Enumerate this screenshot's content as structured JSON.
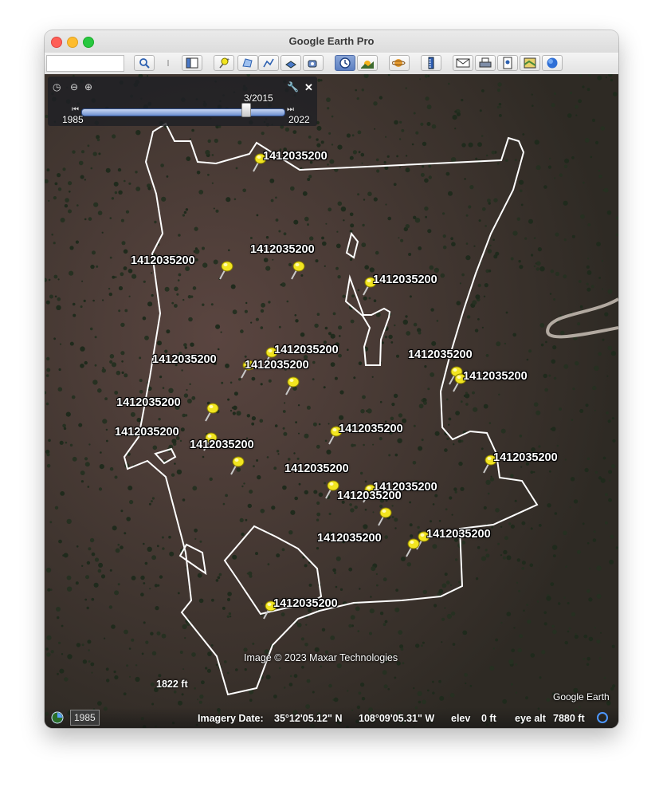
{
  "window": {
    "title": "Google Earth Pro"
  },
  "toolbar": {
    "buttons": [
      {
        "name": "search-icon",
        "state": "normal"
      },
      {
        "name": "tour-icon",
        "state": "disabled"
      },
      {
        "name": "sidebar-icon",
        "state": "normal"
      },
      {
        "name": "placemark-icon",
        "state": "normal"
      },
      {
        "name": "polygon-icon",
        "state": "normal"
      },
      {
        "name": "path-icon",
        "state": "normal"
      },
      {
        "name": "image-overlay-icon",
        "state": "normal"
      },
      {
        "name": "record-tour-icon",
        "state": "normal"
      },
      {
        "name": "historical-imagery-icon",
        "state": "active"
      },
      {
        "name": "sunlight-icon",
        "state": "normal"
      },
      {
        "name": "planets-icon",
        "state": "normal"
      },
      {
        "name": "ruler-icon",
        "state": "normal"
      },
      {
        "name": "email-icon",
        "state": "normal"
      },
      {
        "name": "print-icon",
        "state": "normal"
      },
      {
        "name": "save-image-icon",
        "state": "normal"
      },
      {
        "name": "view-in-maps-icon",
        "state": "normal"
      },
      {
        "name": "earth-gallery-icon",
        "state": "normal"
      }
    ]
  },
  "time_slider": {
    "current_date": "3/2015",
    "start_year": "1985",
    "end_year": "2022",
    "position_fraction": 0.81
  },
  "placemarks": [
    {
      "label": "1412035200"
    },
    {
      "label": "1412035200"
    },
    {
      "label": "1412035200"
    },
    {
      "label": "1412035200"
    },
    {
      "label": "1412035200"
    },
    {
      "label": "1412035200"
    },
    {
      "label": "1412035200"
    },
    {
      "label": "1412035200"
    },
    {
      "label": "1412035200"
    },
    {
      "label": "1412035200"
    },
    {
      "label": "1412035200"
    },
    {
      "label": "1412035200"
    },
    {
      "label": "1412035200"
    },
    {
      "label": "1412035200"
    },
    {
      "label": "1412035200"
    },
    {
      "label": "1412035200"
    },
    {
      "label": "1412035200"
    },
    {
      "label": "1412035200"
    },
    {
      "label": "1412035200"
    },
    {
      "label": "1412035200"
    },
    {
      "label": "1412035200"
    },
    {
      "label": "1412035200"
    }
  ],
  "map": {
    "attribution": "Image © 2023 Maxar Technologies",
    "scale_label": "1822 ft",
    "logo": "Google Earth"
  },
  "status": {
    "year_badge": "1985",
    "imagery_date_label": "Imagery Date:",
    "latitude": "35°12'05.12\" N",
    "longitude": "108°09'05.31\" W",
    "elev_label": "elev",
    "elev_value": "0 ft",
    "eye_alt_label": "eye alt",
    "eye_alt_value": "7880 ft"
  },
  "colors": {
    "pin": "#f2e520",
    "boundary": "#ffffff",
    "ground": "#4a3b35"
  }
}
